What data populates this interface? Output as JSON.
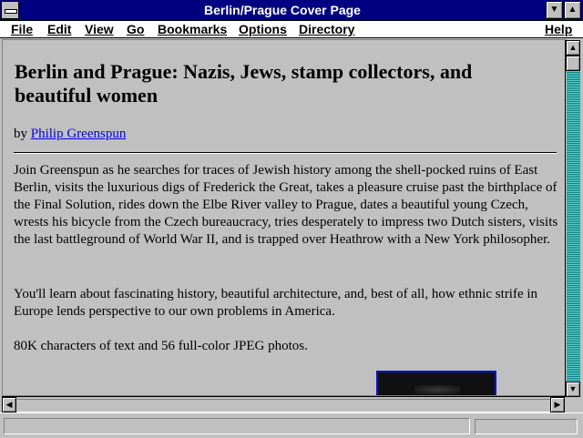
{
  "window": {
    "title": "Berlin/Prague Cover Page"
  },
  "menubar": {
    "items": [
      {
        "label": "File"
      },
      {
        "label": "Edit"
      },
      {
        "label": "View"
      },
      {
        "label": "Go"
      },
      {
        "label": "Bookmarks"
      },
      {
        "label": "Options"
      },
      {
        "label": "Directory"
      },
      {
        "label": "Help"
      }
    ]
  },
  "document": {
    "heading": "Berlin and Prague: Nazis, Jews, stamp collectors, and beautiful women",
    "byline_prefix": "by ",
    "author_link": "Philip Greenspun",
    "paragraphs": [
      "Join Greenspun as he searches for traces of Jewish history among the shell-pocked ruins of East Berlin, visits the luxurious digs of Frederick the Great, takes a pleasure cruise past the birthplace of the Final Solution, rides down the Elbe River valley to Prague, dates a beautiful young Czech, wrests his bicycle from the Czech bureaucracy, tries desperately to impress two Dutch sisters, visits the last battleground of World War II, and is trapped over Heathrow with a New York philosopher.",
      "You'll learn about fascinating history, beautiful architecture, and, best of all, how ethnic strife in Europe lends perspective to our own problems in America.",
      "80K characters of text and 56 full-color JPEG photos."
    ]
  },
  "status": {
    "text": ""
  },
  "colors": {
    "titlebar": "#000080",
    "background": "#c0c0c0",
    "link": "#0000ee",
    "scroll_track": "#40c0c0"
  },
  "icons": {
    "minimize": "down-triangle",
    "maximize": "up-triangle",
    "scroll_up": "up-arrow",
    "scroll_down": "down-arrow",
    "scroll_left": "left-arrow",
    "scroll_right": "right-arrow"
  }
}
